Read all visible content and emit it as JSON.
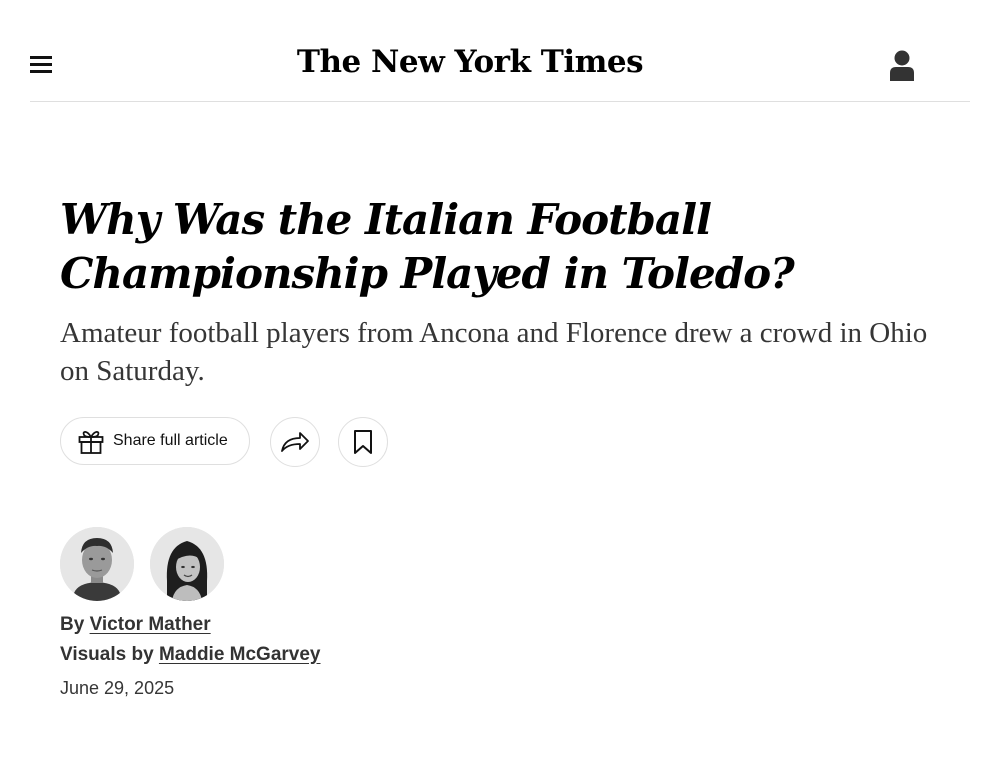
{
  "header": {
    "logo_text": "The New York Times",
    "menu_icon": "hamburger-menu-icon",
    "account_icon": "person-icon"
  },
  "article": {
    "headline": "Why Was the Italian Football Championship Played in Toledo?",
    "summary": "Amateur football players from Ancona and Florence drew a crowd in Ohio on Saturday.",
    "share_label": "Share full article",
    "share_icon": "gift-icon",
    "forward_icon": "share-arrow-icon",
    "save_icon": "bookmark-icon",
    "byline": {
      "by_prefix": "By",
      "author": "Victor Mather",
      "visuals_prefix": "Visuals by",
      "visuals_author": "Maddie McGarvey"
    },
    "date": "June 29, 2025"
  },
  "colors": {
    "text": "#121212",
    "muted_text": "#363636",
    "border": "#dfdfdf",
    "background": "#ffffff"
  }
}
